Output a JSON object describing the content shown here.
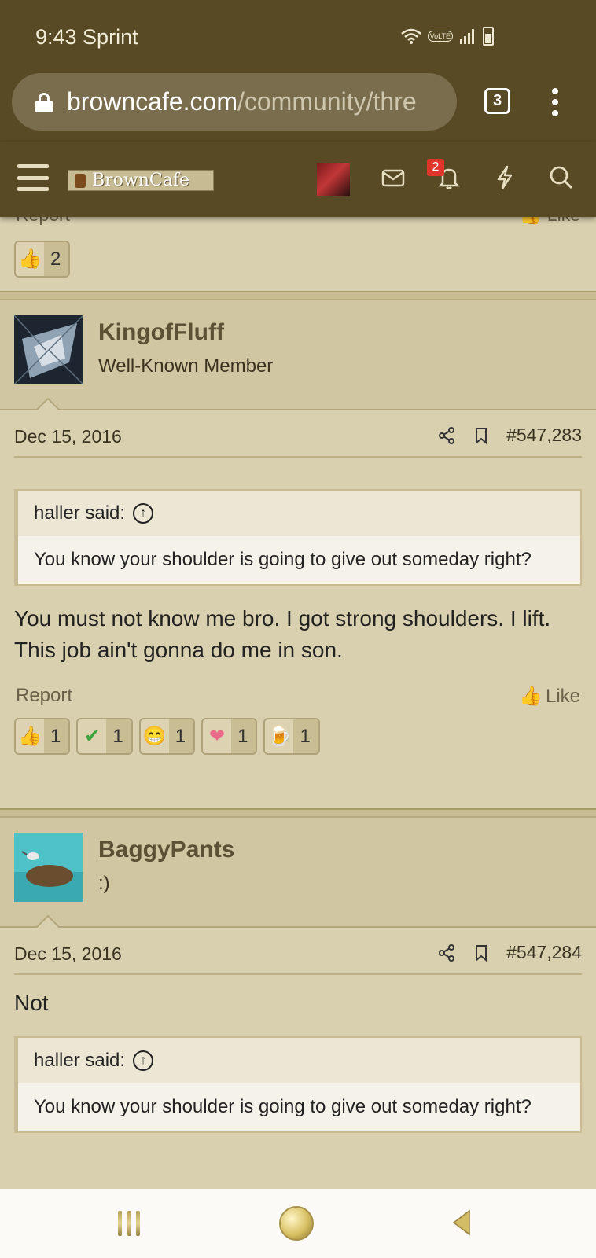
{
  "status_bar": {
    "time": "9:43 Sprint",
    "volte": "VoLTE"
  },
  "browser": {
    "url_domain": "browncafe.com",
    "url_path": "/community/thre",
    "tab_count": "3"
  },
  "site": {
    "logo_text": "BrownCafe",
    "alerts_badge": "2"
  },
  "previous_post": {
    "report_label": "Report",
    "like_label": "Like",
    "reactions": [
      {
        "icon": "thumbs-up-icon",
        "count": "2"
      }
    ]
  },
  "posts": [
    {
      "username": "KingofFluff",
      "user_title": "Well-Known Member",
      "date": "Dec 15, 2016",
      "post_number": "#547,283",
      "quote": {
        "author": "haller said:",
        "text": "You know your shoulder is going to give out someday right?"
      },
      "message": "You must not know me bro. I got strong shoulders. I lift. This job ain't gonna do me in son.",
      "report_label": "Report",
      "like_label": "Like",
      "reactions": [
        {
          "icon": "thumbs-up-icon",
          "count": "1"
        },
        {
          "icon": "checkmark-icon",
          "count": "1"
        },
        {
          "icon": "grin-icon",
          "count": "1"
        },
        {
          "icon": "heart-icon",
          "count": "1"
        },
        {
          "icon": "beer-icon",
          "count": "1"
        }
      ]
    },
    {
      "username": "BaggyPants",
      "user_title": ":)",
      "date": "Dec 15, 2016",
      "post_number": "#547,284",
      "message": "Not",
      "quote": {
        "author": "haller said:",
        "text": "You know your shoulder is going to give out someday right?"
      }
    }
  ],
  "colors": {
    "header_bg": "#574a24",
    "page_bg": "#d8d0ae",
    "badge_red": "#e0352b",
    "username_color": "#5c5134"
  }
}
